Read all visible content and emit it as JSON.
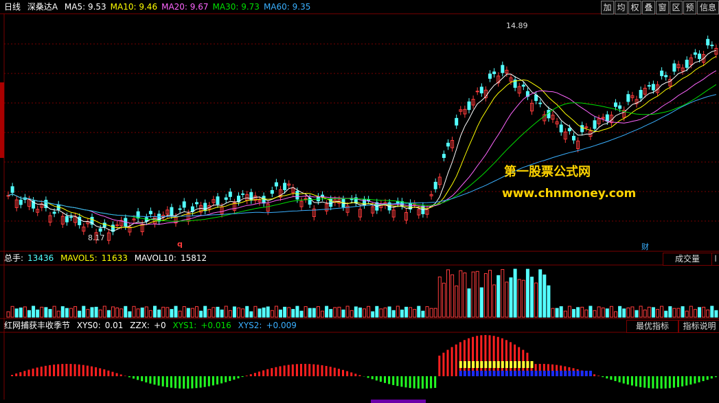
{
  "top": {
    "period": "日线",
    "stock": "深桑达A",
    "ma": [
      {
        "label": "MA5:",
        "value": "9.53",
        "color": "#ffffff"
      },
      {
        "label": "MA10:",
        "value": "9.46",
        "color": "#ffff00"
      },
      {
        "label": "MA20:",
        "value": "9.67",
        "color": "#ff66ff"
      },
      {
        "label": "MA30:",
        "value": "9.73",
        "color": "#00e000"
      },
      {
        "label": "MA60:",
        "value": "9.35",
        "color": "#3ab0ff"
      }
    ]
  },
  "toolbar": [
    "加",
    "均",
    "权",
    "叠",
    "窗",
    "区",
    "预",
    "信息"
  ],
  "price": {
    "high_label": "14.89",
    "low_label": "8.17",
    "mark_q": "q",
    "mark_cai": "财"
  },
  "watermark": {
    "line1": "第一股票公式网",
    "line2": "www.chnmoney.com"
  },
  "volume": {
    "label": "总手:",
    "value": "13436",
    "mavol5_label": "MAVOL5:",
    "mavol5": "11633",
    "mavol10_label": "MAVOL10:",
    "mavol10": "15812",
    "button": "成交量",
    "button_small": "l"
  },
  "indicator": {
    "name": "红网捕获丰收季节",
    "xys0_label": "XYS0:",
    "xys0": "0.01",
    "zzx_label": "ZZX:",
    "zzx": "+0",
    "xys1_label": "XYS1:",
    "xys1": "+0.016",
    "xys2_label": "XYS2:",
    "xys2": "+0.009",
    "btn_best": "最优指标",
    "btn_help": "指标说明"
  },
  "colors": {
    "up": "#ff3c3c",
    "down": "#54ffff",
    "grid": "#7a0000"
  }
}
